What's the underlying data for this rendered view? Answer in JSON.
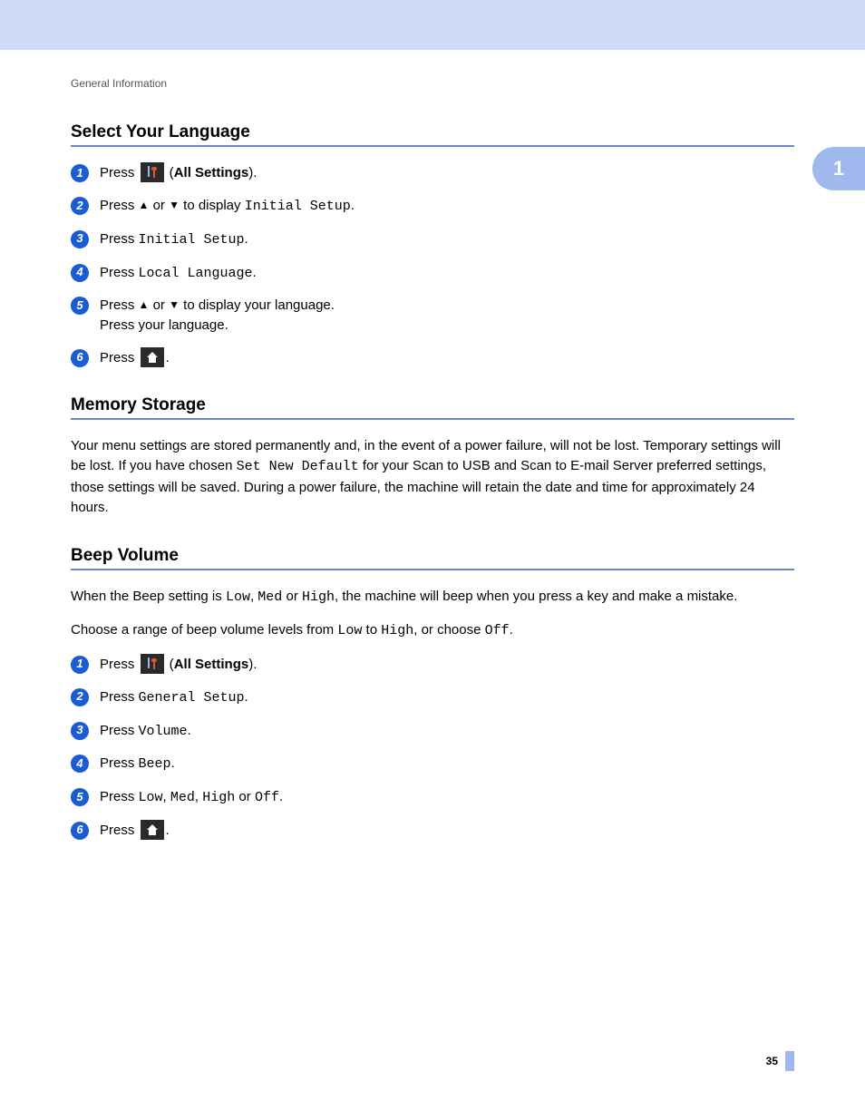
{
  "breadcrumb": "General Information",
  "chapter_tab": "1",
  "page_number": "35",
  "sections": {
    "select_language": {
      "title": "Select Your Language",
      "steps": [
        {
          "pre": "Press ",
          "icon": "tools",
          "post_open": " (",
          "bold": "All Settings",
          "post_close": ")."
        },
        {
          "pre": "Press ",
          "tri_up": "▲",
          "mid1": " or ",
          "tri_down": "▼",
          "mid2": " to display ",
          "mono": "Initial Setup",
          "end": "."
        },
        {
          "pre": "Press ",
          "mono": "Initial Setup",
          "end": "."
        },
        {
          "pre": "Press ",
          "mono": "Local Language",
          "end": "."
        },
        {
          "line1_pre": "Press ",
          "tri_up": "▲",
          "line1_mid": " or ",
          "tri_down": "▼",
          "line1_end": " to display your language.",
          "line2": "Press your language."
        },
        {
          "pre": "Press ",
          "icon": "home",
          "end": "."
        }
      ]
    },
    "memory_storage": {
      "title": "Memory Storage",
      "para_parts": {
        "a": "Your menu settings are stored permanently and, in the event of a power failure, will not be lost. Temporary settings will be lost. If you have chosen ",
        "mono": "Set New Default",
        "b": " for your Scan to USB and Scan to E-mail Server preferred settings, those settings will be saved. During a power failure, the machine will retain the date and time for approximately 24 hours."
      }
    },
    "beep_volume": {
      "title": "Beep Volume",
      "p1": {
        "a": "When the Beep setting is ",
        "m1": "Low",
        "b": ", ",
        "m2": "Med",
        "c": " or ",
        "m3": "High",
        "d": ", the machine will beep when you press a key and make a mistake."
      },
      "p2": {
        "a": "Choose a range of beep volume levels from ",
        "m1": "Low",
        "b": " to ",
        "m2": "High",
        "c": ", or choose ",
        "m3": "Off",
        "d": "."
      },
      "steps": [
        {
          "pre": "Press ",
          "icon": "tools",
          "post_open": " (",
          "bold": "All Settings",
          "post_close": ")."
        },
        {
          "pre": "Press ",
          "mono": "General Setup",
          "end": "."
        },
        {
          "pre": "Press ",
          "mono": "Volume",
          "end": "."
        },
        {
          "pre": "Press ",
          "mono": "Beep",
          "end": "."
        },
        {
          "pre": "Press ",
          "m1": "Low",
          "s1": ", ",
          "m2": "Med",
          "s2": ", ",
          "m3": "High",
          "s3": " or ",
          "m4": "Off",
          "end": "."
        },
        {
          "pre": "Press ",
          "icon": "home",
          "end": "."
        }
      ]
    }
  }
}
